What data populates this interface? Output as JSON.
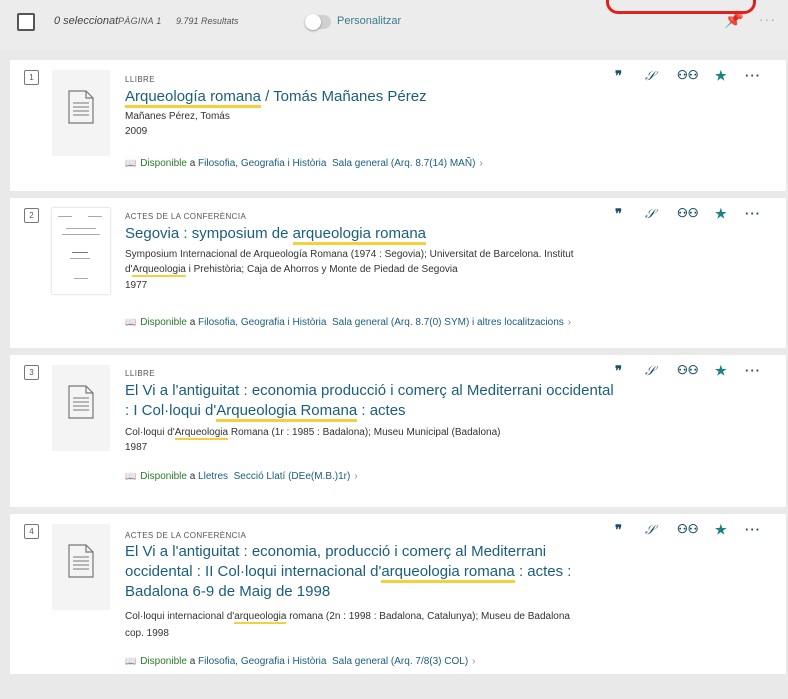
{
  "toolbar": {
    "selected": "0 seleccionat",
    "page": "PÀGINA 1",
    "results": "9.791 Resultats",
    "personalize": "Personalitzar"
  },
  "actions": {
    "quote": "❞",
    "link": "🔗",
    "binoculars": "ꗃ",
    "pin": "📌",
    "more": "···"
  },
  "records": [
    {
      "num": "1",
      "type": "LLIBRE",
      "title_pre": "",
      "title_hl": "Arqueología romana",
      "title_post": " / Tomás Mañanes Pérez",
      "author": "Mañanes Pérez, Tomás",
      "year": "2009",
      "avail_status": "Disponible",
      "avail_a": "a",
      "avail_lib": "Filosofia, Geografia i Història",
      "avail_loc": "Sala general (Arq. 8.7(14) MAÑ)"
    },
    {
      "num": "2",
      "type": "ACTES DE LA CONFERÈNCIA",
      "title_pre": "Segovia : symposium de ",
      "title_hl": "arqueologia romana",
      "title_post": "",
      "author_l1": "Symposium Internacional de Arqueología Romana (1974 : Segovia); Universitat de Barcelona. Institut",
      "author_l2_pre": "d'",
      "author_l2_hl": "Arqueologia",
      "author_l2_post": " i Prehistòria; Caja de Ahorros y Monte de Piedad de Segovia",
      "year": "1977",
      "avail_status": "Disponible",
      "avail_a": "a",
      "avail_lib": "Filosofia, Geografia i Història",
      "avail_loc": "Sala general (Arq. 8.7(0) SYM) i altres localitzacions"
    },
    {
      "num": "3",
      "type": "LLIBRE",
      "title_l1": "El Vi a l'antiguitat : economia producció i comerç al Mediterrani occidental",
      "title_l2_pre": ": I Col·loqui d'",
      "title_l2_hl": "Arqueologia Romana",
      "title_l2_post": " : actes",
      "author_pre": "Col·loqui d'",
      "author_hl": "Arqueologia",
      "author_post": " Romana (1r : 1985 : Badalona); Museu Municipal (Badalona)",
      "year": "1987",
      "avail_status": "Disponible",
      "avail_a": "a",
      "avail_lib": "Lletres",
      "avail_loc": "Secció Llatí (DEe(M.B.)1r)"
    },
    {
      "num": "4",
      "type": "ACTES DE LA CONFERÈNCIA",
      "title_l1": "El Vi a l'antiguitat : economia, producció i comerç al Mediterrani",
      "title_l2_pre": "occidental : II Col·loqui internacional d'",
      "title_l2_hl": "arqueologia romana",
      "title_l2_post": " : actes :",
      "title_l3": "Badalona 6-9 de Maig de 1998",
      "author_pre": "Col·loqui internacional d'",
      "author_hl": "arqueologia",
      "author_post": " romana (2n : 1998 : Badalona, Catalunya); Museu de Badalona",
      "year": "cop. 1998",
      "avail_status": "Disponible",
      "avail_a": "a",
      "avail_lib": "Filosofia, Geografia i Història",
      "avail_loc": "Sala general (Arq. 7/8(3) COL)"
    }
  ]
}
